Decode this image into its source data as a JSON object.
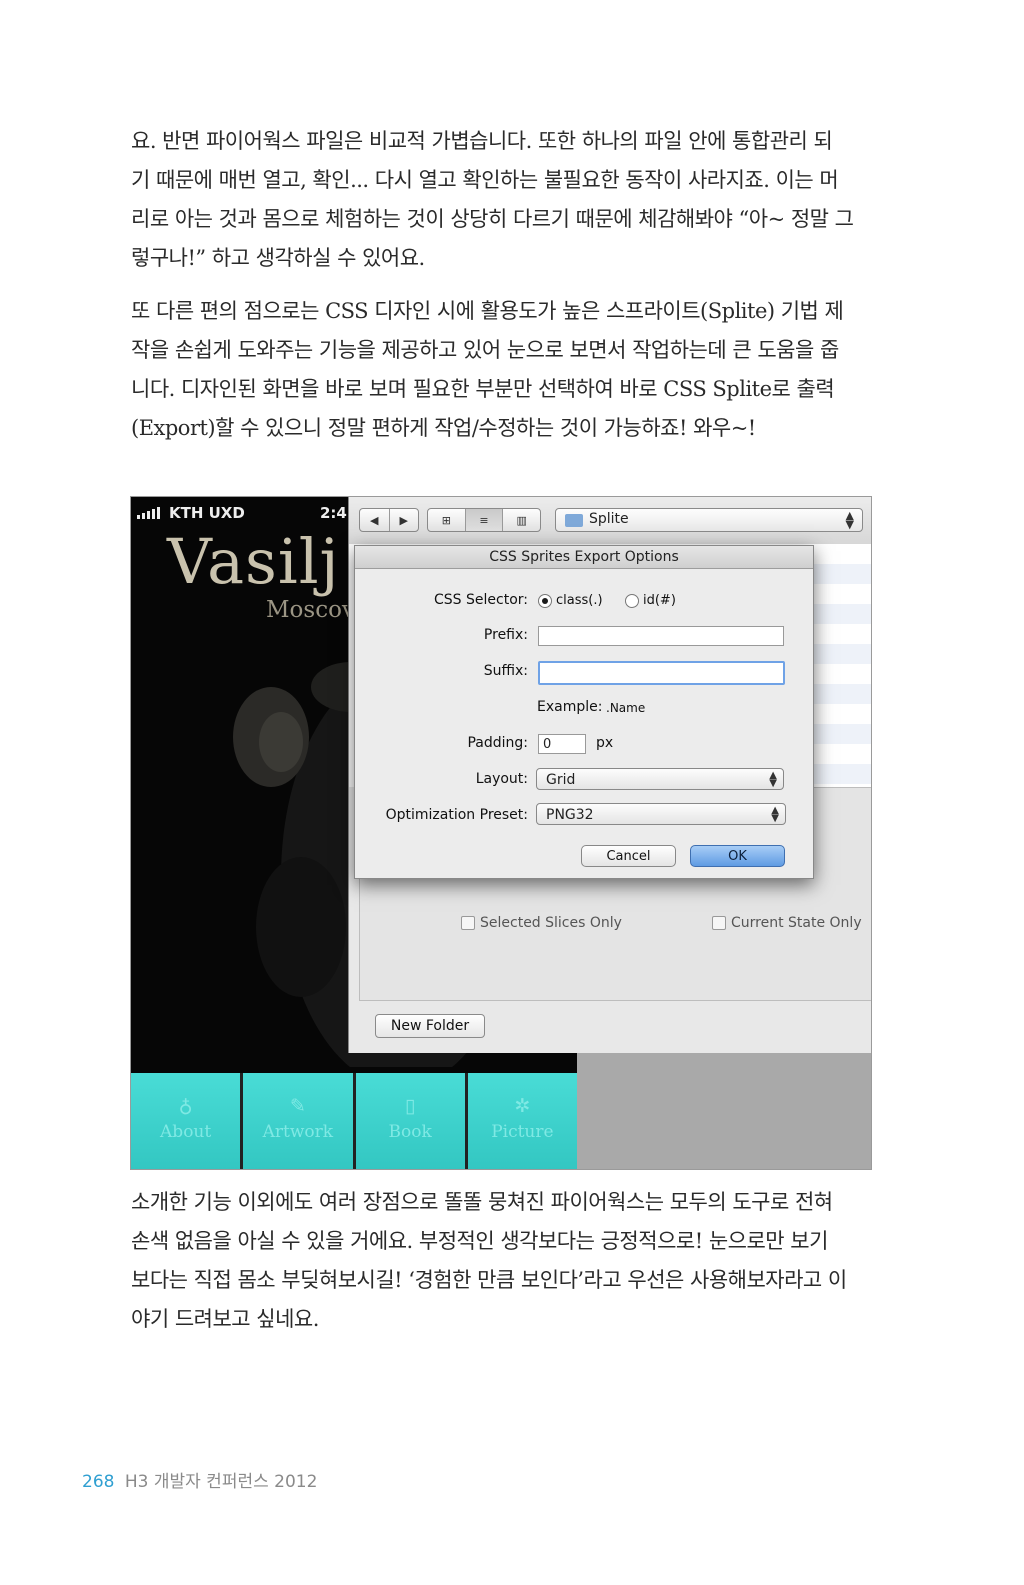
{
  "paragraph1": [
    "요. 반면 파이어웍스 파일은 비교적 가볍습니다. 또한 하나의 파일 안에 통합관리 되",
    "기 때문에 매번 열고, 확인... 다시 열고 확인하는 불필요한 동작이 사라지죠. 이는 머",
    "리로 아는 것과 몸으로 체험하는 것이 상당히 다르기 때문에 체감해봐야 “아~ 정말 그",
    "렇구나!” 하고 생각하실 수 있어요."
  ],
  "paragraph2": [
    "또 다른 편의 점으로는 CSS 디자인 시에 활용도가 높은 스프라이트(Splite) 기법 제",
    "작을 손쉽게 도와주는 기능을 제공하고 있어 눈으로 보면서 작업하는데 큰 도움을 줍",
    "니다. 디자인된 화면을 바로 보며 필요한 부분만 선택하여 바로 CSS Splite로 출력",
    "(Export)할 수 있으니 정말 편하게 작업/수정하는 것이 가능하죠! 와우~!"
  ],
  "paragraph3": [
    "소개한 기능 이외에도 여러 장점으로 똘똘 뭉쳐진 파이어웍스는 모두의 도구로 전혀",
    "손색 없음을 아실 수 있을 거에요. 부정적인 생각보다는 긍정적으로! 눈으로만 보기",
    "보다는 직접 몸소 부딪혀보시길! ‘경험한 만큼 보인다’라고 우선은 사용해보자라고 이",
    "야기 드려보고 싶네요."
  ],
  "figure": {
    "phone": {
      "carrier": "KTH UXD",
      "time": "2:4",
      "title": "Vasilj",
      "subtitle": "Moscov",
      "tabs": [
        {
          "label": "About",
          "icon": "person-icon",
          "glyph": "♁"
        },
        {
          "label": "Artwork",
          "icon": "brush-icon",
          "glyph": "✎"
        },
        {
          "label": "Book",
          "icon": "book-icon",
          "glyph": "▯"
        },
        {
          "label": "Picture",
          "icon": "gear-icon",
          "glyph": "✲"
        }
      ]
    },
    "finder": {
      "nav_back": "◀",
      "nav_forward": "▶",
      "view_icon": "⊞",
      "view_list": "≡",
      "view_column": "▥",
      "location": "Splite",
      "selected_slices_only": "Selected Slices Only",
      "current_state_only": "Current State Only",
      "new_folder": "New Folder"
    },
    "dialog": {
      "title": "CSS Sprites Export Options",
      "css_selector_label": "CSS Selector:",
      "option_class": "class(.)",
      "option_id": "id(#)",
      "prefix_label": "Prefix:",
      "prefix_value": "",
      "suffix_label": "Suffix:",
      "suffix_value": "",
      "example_label": "Example:",
      "example_value": ".Name",
      "padding_label": "Padding:",
      "padding_value": "0",
      "padding_unit": "px",
      "layout_label": "Layout:",
      "layout_value": "Grid",
      "preset_label": "Optimization Preset:",
      "preset_value": "PNG32",
      "cancel": "Cancel",
      "ok": "OK"
    }
  },
  "footer": {
    "page_number": "268",
    "title": "H3 개발자 컨퍼런스 2012"
  }
}
